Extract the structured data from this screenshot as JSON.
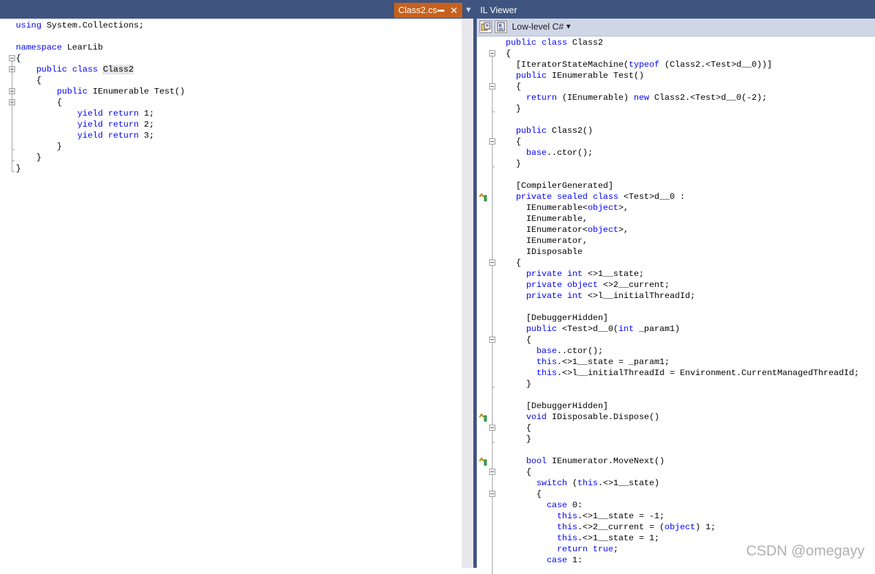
{
  "tabs": {
    "active_tab": "Class2.cs",
    "pin_icon": "pin-icon",
    "close_icon": "close-icon",
    "dropdown_icon": "chevron-down-icon"
  },
  "il_viewer": {
    "title": "IL Viewer",
    "toolbar": {
      "button_icons": [
        "il-view-icon",
        "il-settings-icon"
      ],
      "language_selector": "Low-level C#",
      "language_dropdown_icon": "chevron-down-icon"
    }
  },
  "colors": {
    "header_bar": "#3f5580",
    "active_tab": "#c6601d",
    "keyword": "#0000ff",
    "toolbar": "#cfd6e5"
  },
  "source_code": {
    "file": "Class2.cs",
    "lines": [
      [
        {
          "t": "",
          "k": false
        },
        {
          "t": "using",
          "k": true
        },
        {
          "t": " System.Collections;",
          "k": false
        }
      ],
      [],
      [
        {
          "t": "",
          "k": false
        },
        {
          "t": "namespace",
          "k": true
        },
        {
          "t": " LearLib",
          "k": false
        }
      ],
      [
        {
          "t": "{",
          "k": false
        }
      ],
      [
        {
          "t": "    ",
          "k": false
        },
        {
          "t": "public",
          "k": true
        },
        {
          "t": " ",
          "k": false
        },
        {
          "t": "class",
          "k": true
        },
        {
          "t": " ",
          "k": false
        },
        {
          "t": "Class2",
          "k": false,
          "h": true
        }
      ],
      [
        {
          "t": "    {",
          "k": false
        }
      ],
      [
        {
          "t": "        ",
          "k": false
        },
        {
          "t": "public",
          "k": true
        },
        {
          "t": " IEnumerable Test()",
          "k": false
        }
      ],
      [
        {
          "t": "        {",
          "k": false
        }
      ],
      [
        {
          "t": "            ",
          "k": false
        },
        {
          "t": "yield",
          "k": true
        },
        {
          "t": " ",
          "k": false
        },
        {
          "t": "return",
          "k": true
        },
        {
          "t": " 1;",
          "k": false
        }
      ],
      [
        {
          "t": "            ",
          "k": false
        },
        {
          "t": "yield",
          "k": true
        },
        {
          "t": " ",
          "k": false
        },
        {
          "t": "return",
          "k": true
        },
        {
          "t": " 2;",
          "k": false
        }
      ],
      [
        {
          "t": "            ",
          "k": false
        },
        {
          "t": "yield",
          "k": true
        },
        {
          "t": " ",
          "k": false
        },
        {
          "t": "return",
          "k": true
        },
        {
          "t": " 3;",
          "k": false
        }
      ],
      [
        {
          "t": "        }",
          "k": false
        }
      ],
      [
        {
          "t": "    }",
          "k": false
        }
      ],
      [
        {
          "t": "}",
          "k": false
        }
      ]
    ]
  },
  "il_code": {
    "lines": [
      [
        {
          "t": "public",
          "k": true
        },
        {
          "t": " ",
          "k": false
        },
        {
          "t": "class",
          "k": true
        },
        {
          "t": " Class2",
          "k": false
        }
      ],
      [
        {
          "t": "{",
          "k": false
        }
      ],
      [
        {
          "t": "  [IteratorStateMachine(",
          "k": false
        },
        {
          "t": "typeof",
          "k": true
        },
        {
          "t": " (Class2.<Test>d__0))]",
          "k": false
        }
      ],
      [
        {
          "t": "  ",
          "k": false
        },
        {
          "t": "public",
          "k": true
        },
        {
          "t": " IEnumerable Test()",
          "k": false
        }
      ],
      [
        {
          "t": "  {",
          "k": false
        }
      ],
      [
        {
          "t": "    ",
          "k": false
        },
        {
          "t": "return",
          "k": true
        },
        {
          "t": " (IEnumerable) ",
          "k": false
        },
        {
          "t": "new",
          "k": true
        },
        {
          "t": " Class2.<Test>d__0(-2);",
          "k": false
        }
      ],
      [
        {
          "t": "  }",
          "k": false
        }
      ],
      [],
      [
        {
          "t": "  ",
          "k": false
        },
        {
          "t": "public",
          "k": true
        },
        {
          "t": " Class2()",
          "k": false
        }
      ],
      [
        {
          "t": "  {",
          "k": false
        }
      ],
      [
        {
          "t": "    ",
          "k": false
        },
        {
          "t": "base",
          "k": true
        },
        {
          "t": "..ctor();",
          "k": false
        }
      ],
      [
        {
          "t": "  }",
          "k": false
        }
      ],
      [],
      [
        {
          "t": "  [CompilerGenerated]",
          "k": false
        }
      ],
      [
        {
          "t": "  ",
          "k": false
        },
        {
          "t": "private",
          "k": true
        },
        {
          "t": " ",
          "k": false
        },
        {
          "t": "sealed",
          "k": true
        },
        {
          "t": " ",
          "k": false
        },
        {
          "t": "class",
          "k": true
        },
        {
          "t": " <Test>d__0 :",
          "k": false
        }
      ],
      [
        {
          "t": "    IEnumerable<",
          "k": false
        },
        {
          "t": "object",
          "k": true
        },
        {
          "t": ">,",
          "k": false
        }
      ],
      [
        {
          "t": "    IEnumerable,",
          "k": false
        }
      ],
      [
        {
          "t": "    IEnumerator<",
          "k": false
        },
        {
          "t": "object",
          "k": true
        },
        {
          "t": ">,",
          "k": false
        }
      ],
      [
        {
          "t": "    IEnumerator,",
          "k": false
        }
      ],
      [
        {
          "t": "    IDisposable",
          "k": false
        }
      ],
      [
        {
          "t": "  {",
          "k": false
        }
      ],
      [
        {
          "t": "    ",
          "k": false
        },
        {
          "t": "private",
          "k": true
        },
        {
          "t": " ",
          "k": false
        },
        {
          "t": "int",
          "k": true
        },
        {
          "t": " <>1__state;",
          "k": false
        }
      ],
      [
        {
          "t": "    ",
          "k": false
        },
        {
          "t": "private",
          "k": true
        },
        {
          "t": " ",
          "k": false
        },
        {
          "t": "object",
          "k": true
        },
        {
          "t": " <>2__current;",
          "k": false
        }
      ],
      [
        {
          "t": "    ",
          "k": false
        },
        {
          "t": "private",
          "k": true
        },
        {
          "t": " ",
          "k": false
        },
        {
          "t": "int",
          "k": true
        },
        {
          "t": " <>l__initialThreadId;",
          "k": false
        }
      ],
      [],
      [
        {
          "t": "    [DebuggerHidden]",
          "k": false
        }
      ],
      [
        {
          "t": "    ",
          "k": false
        },
        {
          "t": "public",
          "k": true
        },
        {
          "t": " <Test>d__0(",
          "k": false
        },
        {
          "t": "int",
          "k": true
        },
        {
          "t": " _param1)",
          "k": false
        }
      ],
      [
        {
          "t": "    {",
          "k": false
        }
      ],
      [
        {
          "t": "      ",
          "k": false
        },
        {
          "t": "base",
          "k": true
        },
        {
          "t": "..ctor();",
          "k": false
        }
      ],
      [
        {
          "t": "      ",
          "k": false
        },
        {
          "t": "this",
          "k": true
        },
        {
          "t": ".<>1__state = _param1;",
          "k": false
        }
      ],
      [
        {
          "t": "      ",
          "k": false
        },
        {
          "t": "this",
          "k": true
        },
        {
          "t": ".<>l__initialThreadId = Environment.CurrentManagedThreadId;",
          "k": false
        }
      ],
      [
        {
          "t": "    }",
          "k": false
        }
      ],
      [],
      [
        {
          "t": "    [DebuggerHidden]",
          "k": false
        }
      ],
      [
        {
          "t": "    ",
          "k": false
        },
        {
          "t": "void",
          "k": true
        },
        {
          "t": " IDisposable.Dispose()",
          "k": false
        }
      ],
      [
        {
          "t": "    {",
          "k": false
        }
      ],
      [
        {
          "t": "    }",
          "k": false
        }
      ],
      [],
      [
        {
          "t": "    ",
          "k": false
        },
        {
          "t": "bool",
          "k": true
        },
        {
          "t": " IEnumerator.MoveNext()",
          "k": false
        }
      ],
      [
        {
          "t": "    {",
          "k": false
        }
      ],
      [
        {
          "t": "      ",
          "k": false
        },
        {
          "t": "switch",
          "k": true
        },
        {
          "t": " (",
          "k": false
        },
        {
          "t": "this",
          "k": true
        },
        {
          "t": ".<>1__state)",
          "k": false
        }
      ],
      [
        {
          "t": "      {",
          "k": false
        }
      ],
      [
        {
          "t": "        ",
          "k": false
        },
        {
          "t": "case",
          "k": true
        },
        {
          "t": " 0:",
          "k": false
        }
      ],
      [
        {
          "t": "          ",
          "k": false
        },
        {
          "t": "this",
          "k": true
        },
        {
          "t": ".<>1__state = -1;",
          "k": false
        }
      ],
      [
        {
          "t": "          ",
          "k": false
        },
        {
          "t": "this",
          "k": true
        },
        {
          "t": ".<>2__current = (",
          "k": false
        },
        {
          "t": "object",
          "k": true
        },
        {
          "t": ") 1;",
          "k": false
        }
      ],
      [
        {
          "t": "          ",
          "k": false
        },
        {
          "t": "this",
          "k": true
        },
        {
          "t": ".<>1__state = 1;",
          "k": false
        }
      ],
      [
        {
          "t": "          ",
          "k": false
        },
        {
          "t": "return",
          "k": true
        },
        {
          "t": " ",
          "k": false
        },
        {
          "t": "true",
          "k": true
        },
        {
          "t": ";",
          "k": false
        }
      ],
      [
        {
          "t": "        ",
          "k": false
        },
        {
          "t": "case",
          "k": true
        },
        {
          "t": " 1:",
          "k": false
        }
      ]
    ]
  },
  "gutter": {
    "source_fold_lines": [
      3,
      4,
      6,
      7
    ],
    "il_fold_lines": [
      1,
      4,
      9,
      20,
      27,
      35,
      39,
      41
    ],
    "il_marker_lines": [
      14,
      34,
      38
    ],
    "marker_icon": "implementation-marker-icon"
  },
  "watermark": "CSDN @omegayy"
}
